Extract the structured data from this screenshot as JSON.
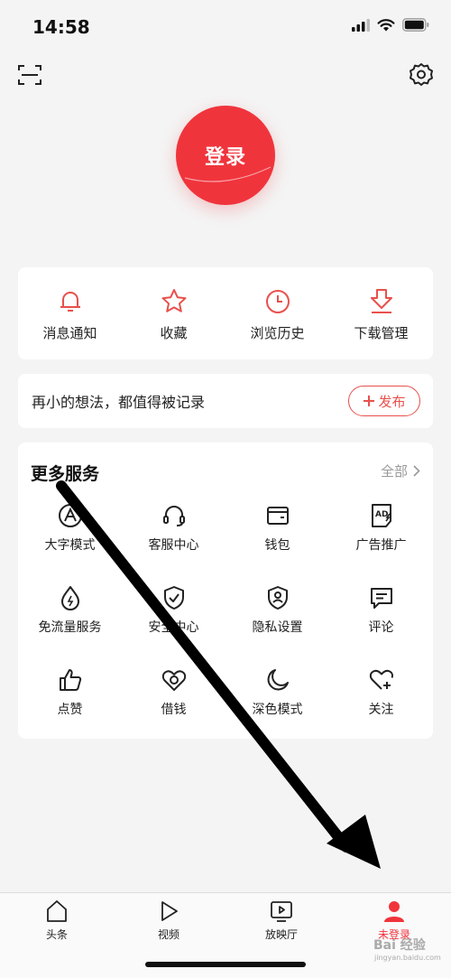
{
  "status": {
    "time": "14:58"
  },
  "top": {
    "scan_icon": "scan-icon",
    "settings_icon": "gear-icon"
  },
  "login": {
    "label": "登录"
  },
  "quick_actions": [
    {
      "label": "消息通知",
      "icon": "bell-icon"
    },
    {
      "label": "收藏",
      "icon": "star-icon"
    },
    {
      "label": "浏览历史",
      "icon": "clock-icon"
    },
    {
      "label": "下载管理",
      "icon": "download-icon"
    }
  ],
  "post": {
    "text": "再小的想法，都值得被记录",
    "button_label": "发布",
    "button_icon": "plus-icon"
  },
  "services": {
    "title": "更多服务",
    "all_label": "全部",
    "items": [
      {
        "label": "大字模式",
        "icon": "large-font-icon"
      },
      {
        "label": "客服中心",
        "icon": "headset-icon"
      },
      {
        "label": "钱包",
        "icon": "wallet-icon"
      },
      {
        "label": "广告推广",
        "icon": "ad-icon"
      },
      {
        "label": "免流量服务",
        "icon": "data-free-icon"
      },
      {
        "label": "安全中心",
        "icon": "shield-icon"
      },
      {
        "label": "隐私设置",
        "icon": "privacy-icon"
      },
      {
        "label": "评论",
        "icon": "comment-icon"
      },
      {
        "label": "点赞",
        "icon": "thumbs-up-icon"
      },
      {
        "label": "借钱",
        "icon": "loan-icon"
      },
      {
        "label": "深色模式",
        "icon": "moon-icon"
      },
      {
        "label": "关注",
        "icon": "heart-plus-icon"
      }
    ]
  },
  "tabs": [
    {
      "label": "头条",
      "icon": "home-icon"
    },
    {
      "label": "视频",
      "icon": "play-icon"
    },
    {
      "label": "放映厅",
      "icon": "screen-icon"
    },
    {
      "label": "未登录",
      "icon": "user-icon",
      "active": true
    }
  ],
  "colors": {
    "accent": "#f0343c",
    "post_outline": "#e8504c",
    "background": "#f4f4f4"
  },
  "watermark": {
    "text": "Bai 经验",
    "sub": "jingyan.baidu.com"
  }
}
